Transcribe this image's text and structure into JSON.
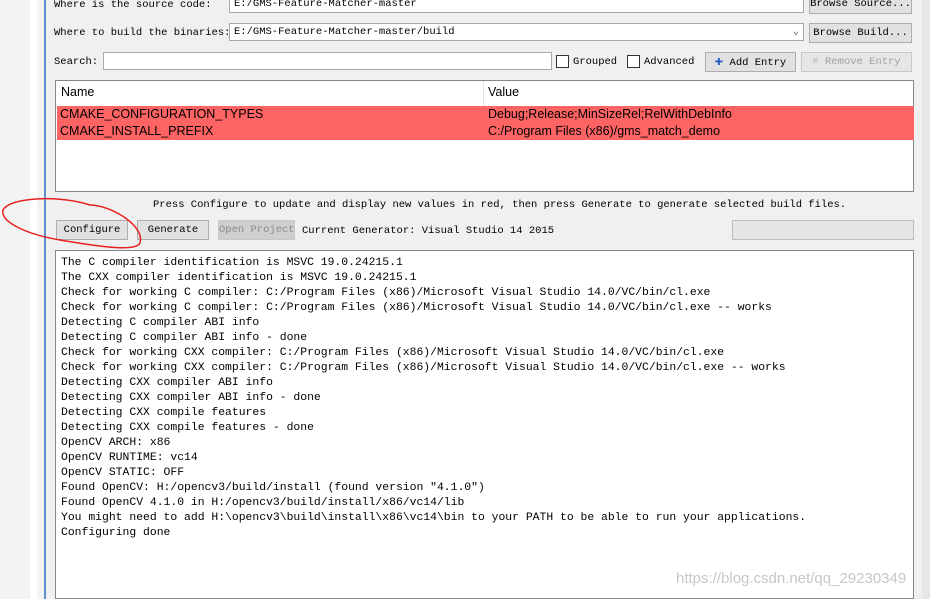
{
  "source": {
    "label": "Where is the source code:",
    "value": "E:/GMS-Feature-Matcher-master",
    "browse": "Browse Source..."
  },
  "build": {
    "label": "Where to build the binaries:",
    "value": "E:/GMS-Feature-Matcher-master/build",
    "browse": "Browse Build..."
  },
  "search": {
    "label": "Search:",
    "value": ""
  },
  "options": {
    "grouped": "Grouped",
    "advanced": "Advanced",
    "add_entry": "Add Entry",
    "remove_entry": "Remove Entry"
  },
  "table": {
    "headers": [
      "Name",
      "Value"
    ],
    "rows": [
      {
        "name": "CMAKE_CONFIGURATION_TYPES",
        "value": "Debug;Release;MinSizeRel;RelWithDebInfo"
      },
      {
        "name": "CMAKE_INSTALL_PREFIX",
        "value": "C:/Program Files (x86)/gms_match_demo"
      }
    ],
    "highlight_color": "#ff6464"
  },
  "hint": "Press Configure to update and display new values in red, then press Generate to generate selected build files.",
  "actions": {
    "configure": "Configure",
    "generate": "Generate",
    "open_project": "Open Project",
    "generator": "Current Generator: Visual Studio 14 2015"
  },
  "output": [
    "The C compiler identification is MSVC 19.0.24215.1",
    "The CXX compiler identification is MSVC 19.0.24215.1",
    "Check for working C compiler: C:/Program Files (x86)/Microsoft Visual Studio 14.0/VC/bin/cl.exe",
    "Check for working C compiler: C:/Program Files (x86)/Microsoft Visual Studio 14.0/VC/bin/cl.exe -- works",
    "Detecting C compiler ABI info",
    "Detecting C compiler ABI info - done",
    "Check for working CXX compiler: C:/Program Files (x86)/Microsoft Visual Studio 14.0/VC/bin/cl.exe",
    "Check for working CXX compiler: C:/Program Files (x86)/Microsoft Visual Studio 14.0/VC/bin/cl.exe -- works",
    "Detecting CXX compiler ABI info",
    "Detecting CXX compiler ABI info - done",
    "Detecting CXX compile features",
    "Detecting CXX compile features - done",
    "OpenCV ARCH: x86",
    "OpenCV RUNTIME: vc14",
    "OpenCV STATIC: OFF",
    "Found OpenCV: H:/opencv3/build/install (found version \"4.1.0\")",
    "Found OpenCV 4.1.0 in H:/opencv3/build/install/x86/vc14/lib",
    "You might need to add H:\\opencv3\\build\\install\\x86\\vc14\\bin to your PATH to be able to run your applications.",
    "Configuring done"
  ],
  "watermark": "https://blog.csdn.net/qq_29230349"
}
